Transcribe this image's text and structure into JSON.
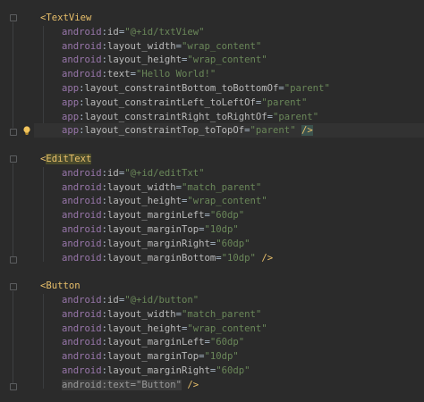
{
  "editor": {
    "lines": [
      {
        "indent": 0,
        "open": "TextView"
      },
      {
        "indent": 1,
        "ns": "android",
        "attr": "id",
        "value": "@+id/txtView"
      },
      {
        "indent": 1,
        "ns": "android",
        "attr": "layout_width",
        "value": "wrap_content"
      },
      {
        "indent": 1,
        "ns": "android",
        "attr": "layout_height",
        "value": "wrap_content"
      },
      {
        "indent": 1,
        "ns": "android",
        "attr": "text",
        "value": "Hello World!"
      },
      {
        "indent": 1,
        "ns": "app",
        "attr": "layout_constraintBottom_toBottomOf",
        "value": "parent"
      },
      {
        "indent": 1,
        "ns": "app",
        "attr": "layout_constraintLeft_toLeftOf",
        "value": "parent"
      },
      {
        "indent": 1,
        "ns": "app",
        "attr": "layout_constraintRight_toRightOf",
        "value": "parent"
      },
      {
        "indent": 1,
        "ns": "app",
        "attr": "layout_constraintTop_toTopOf",
        "value": "parent",
        "close": "/>"
      },
      {
        "blank": true
      },
      {
        "indent": 0,
        "open": "EditText"
      },
      {
        "indent": 1,
        "ns": "android",
        "attr": "id",
        "value": "@+id/editTxt"
      },
      {
        "indent": 1,
        "ns": "android",
        "attr": "layout_width",
        "value": "match_parent"
      },
      {
        "indent": 1,
        "ns": "android",
        "attr": "layout_height",
        "value": "wrap_content"
      },
      {
        "indent": 1,
        "ns": "android",
        "attr": "layout_marginLeft",
        "value": "60dp"
      },
      {
        "indent": 1,
        "ns": "android",
        "attr": "layout_marginTop",
        "value": "10dp"
      },
      {
        "indent": 1,
        "ns": "android",
        "attr": "layout_marginRight",
        "value": "60dp"
      },
      {
        "indent": 1,
        "ns": "android",
        "attr": "layout_marginBottom",
        "value": "10dp",
        "close": "/>"
      },
      {
        "blank": true
      },
      {
        "indent": 0,
        "open": "Button"
      },
      {
        "indent": 1,
        "ns": "android",
        "attr": "id",
        "value": "@+id/button"
      },
      {
        "indent": 1,
        "ns": "android",
        "attr": "layout_width",
        "value": "match_parent"
      },
      {
        "indent": 1,
        "ns": "android",
        "attr": "layout_height",
        "value": "wrap_content"
      },
      {
        "indent": 1,
        "ns": "android",
        "attr": "layout_marginLeft",
        "value": "60dp"
      },
      {
        "indent": 1,
        "ns": "android",
        "attr": "layout_marginTop",
        "value": "10dp"
      },
      {
        "indent": 1,
        "ns": "android",
        "attr": "layout_marginRight",
        "value": "60dp"
      },
      {
        "indent": 1,
        "ns": "android",
        "attr": "text",
        "value": "Button",
        "close": "/>"
      }
    ],
    "colors": {
      "background": "#2b2b2b",
      "tag": "#e8bf6a",
      "namespace": "#9876aa",
      "attribute": "#bababa",
      "value": "#6a8759"
    },
    "icons": {
      "gutter_hint": "lightbulb-icon",
      "fold": "fold-marker-icon"
    }
  }
}
